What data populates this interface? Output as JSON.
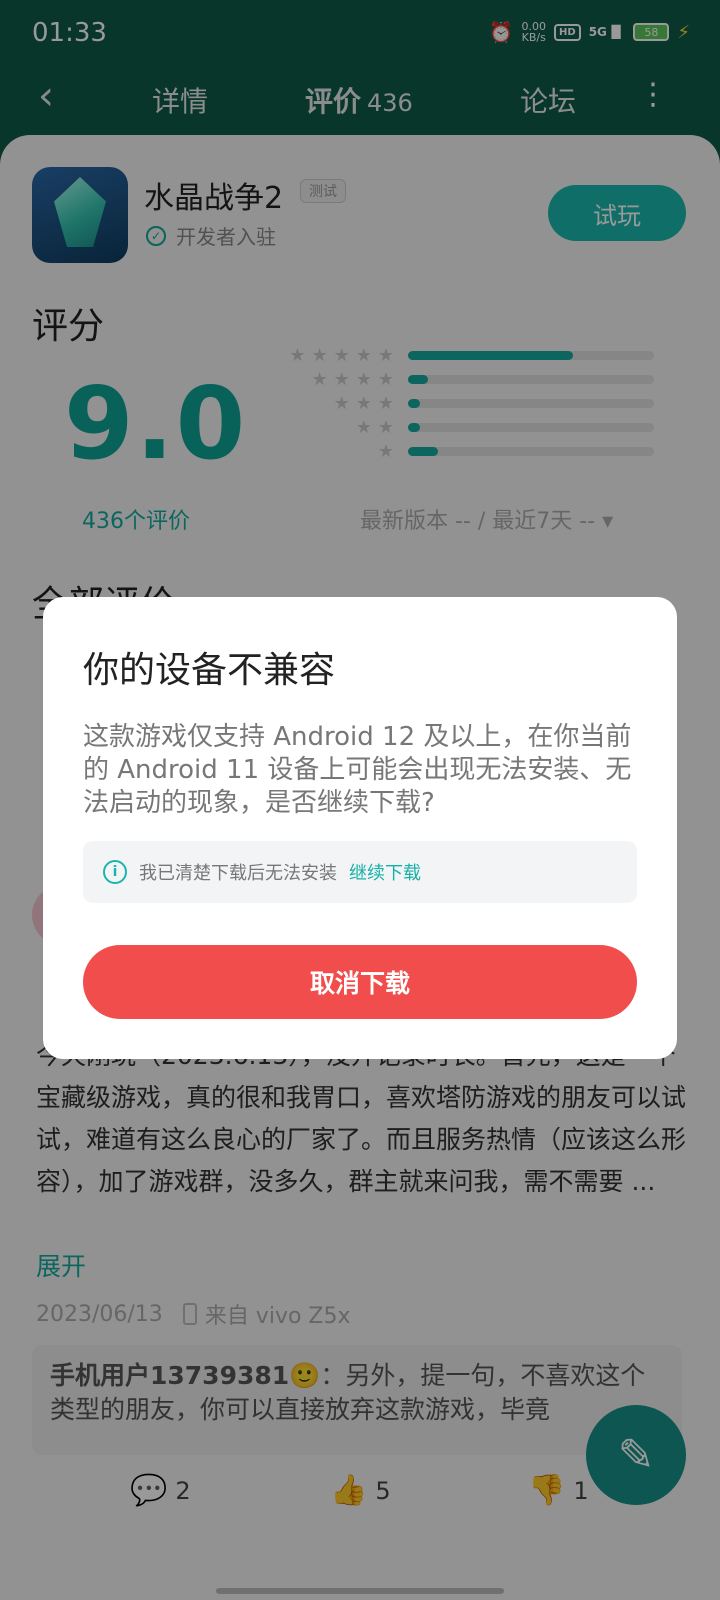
{
  "status_bar": {
    "time": "01:33",
    "net_speed_value": "0.00",
    "net_speed_unit": "KB/s",
    "hd": "HD",
    "network": "5G",
    "battery": "58"
  },
  "header": {
    "tab_detail": "详情",
    "tab_review": "评价",
    "tab_review_count": "436",
    "tab_forum": "论坛"
  },
  "app": {
    "name": "水晶战争2",
    "badge": "测试",
    "developer_label": "开发者入驻",
    "try_button": "试玩"
  },
  "rating": {
    "title": "评分",
    "score": "9.0",
    "count_text": "436个评价",
    "filter_text": "最新版本 -- / 最近7天 -- ▾",
    "distribution": [
      {
        "stars": "★★★★★",
        "fraction": 0.67
      },
      {
        "stars": "★★★★",
        "fraction": 0.08
      },
      {
        "stars": "★★★",
        "fraction": 0.05
      },
      {
        "stars": "★★",
        "fraction": 0.05
      },
      {
        "stars": "★",
        "fraction": 0.12
      }
    ]
  },
  "reviews": {
    "section_title": "全部评价",
    "text": "今天刚玩（2023.6.13），没开记录时长。首先，这是一个宝藏级游戏，真的很和我胃口，喜欢塔防游戏的朋友可以试试，难道有这么良心的厂家了。而且服务热情（应该这么形容），加了游戏群，没多久，群主就来问我，需不需要 ...",
    "expand": "展开",
    "date": "2023/06/13",
    "device": "来自 vivo Z5x",
    "reply_user": "手机用户13739381",
    "reply_text": "：另外，提一句，不喜欢这个类型的朋友，你可以直接放弃这款游戏，毕竟",
    "comment_count": "2",
    "like_count": "5",
    "dislike_count": "1"
  },
  "dialog": {
    "title": "你的设备不兼容",
    "body": "这款游戏仅支持 Android 12 及以上，在你当前的 Android 11 设备上可能会出现无法安装、无法启动的现象，是否继续下载?",
    "notice": "我已清楚下载后无法安装",
    "continue_link": "继续下载",
    "cancel_button": "取消下载"
  },
  "colors": {
    "header_bg": "#0f5a46",
    "accent": "#14a89d",
    "danger": "#f24d4d"
  }
}
